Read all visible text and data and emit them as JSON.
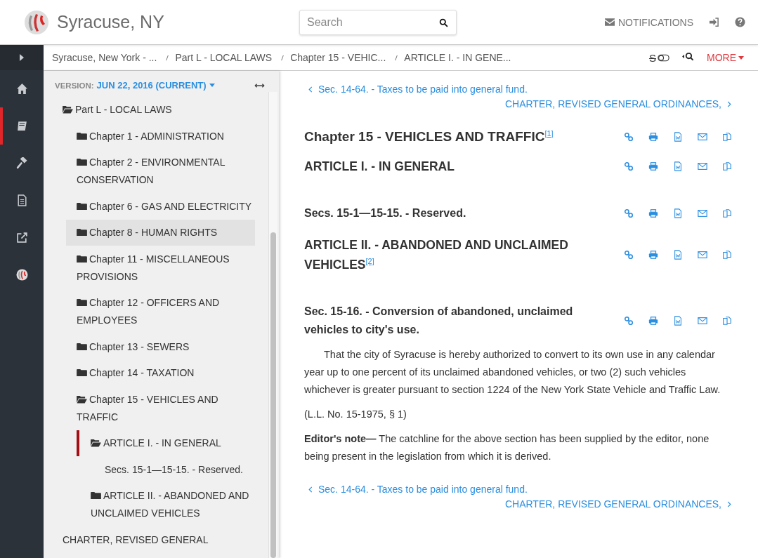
{
  "header": {
    "title": "Syracuse, NY",
    "search": {
      "placeholder": "Search"
    },
    "notifications": "NOTIFICATIONS"
  },
  "rail": {
    "items": [
      {
        "kind": "home",
        "selected": false
      },
      {
        "kind": "book",
        "selected": true
      },
      {
        "kind": "gavel",
        "selected": false
      },
      {
        "kind": "document",
        "selected": false
      },
      {
        "kind": "external",
        "selected": false
      },
      {
        "kind": "logo",
        "selected": false
      }
    ]
  },
  "breadcrumbs": [
    "Syracuse, New York - ...",
    "Part L - LOCAL LAWS",
    "Chapter 15 - VEHIC...",
    "ARTICLE I. - IN GENE..."
  ],
  "toolbar": {
    "compare_glyph": "S",
    "compare_on": false,
    "more": "MORE"
  },
  "sidebar": {
    "version_label": "VERSION:",
    "version": "JUN 22, 2016 (CURRENT)",
    "tree": [
      {
        "kind": "folder",
        "label": "Part L - LOCAL LAWS",
        "expanded": true,
        "selected": false,
        "current": false,
        "children": [
          {
            "kind": "folder",
            "label": "Chapter 1 - ADMINISTRATION",
            "expanded": false,
            "selected": false,
            "current": false
          },
          {
            "kind": "folder",
            "label": "Chapter 2 - ENVIRONMENTAL CONSERVATION",
            "expanded": false,
            "selected": false,
            "current": false
          },
          {
            "kind": "folder",
            "label": "Chapter 6 - GAS AND ELECTRICITY",
            "expanded": false,
            "selected": false,
            "current": false
          },
          {
            "kind": "folder",
            "label": "Chapter 8 - HUMAN RIGHTS",
            "expanded": false,
            "selected": true,
            "current": false
          },
          {
            "kind": "folder",
            "label": "Chapter 11 - MISCELLANEOUS PROVISIONS",
            "expanded": false,
            "selected": false,
            "current": false
          },
          {
            "kind": "folder",
            "label": "Chapter 12 - OFFICERS AND EMPLOYEES",
            "expanded": false,
            "selected": false,
            "current": false
          },
          {
            "kind": "folder",
            "label": "Chapter 13 - SEWERS",
            "expanded": false,
            "selected": false,
            "current": false
          },
          {
            "kind": "folder",
            "label": "Chapter 14 - TAXATION",
            "expanded": false,
            "selected": false,
            "current": false
          },
          {
            "kind": "folder",
            "label": "Chapter 15 - VEHICLES AND TRAFFIC",
            "expanded": true,
            "selected": false,
            "current": false,
            "children": [
              {
                "kind": "folder",
                "label": "ARTICLE I. - IN GENERAL",
                "expanded": true,
                "selected": false,
                "current": true,
                "children": [
                  {
                    "kind": "section",
                    "label": "Secs. 15-1—15-15. - Reserved.",
                    "selected": false,
                    "current": false
                  }
                ]
              },
              {
                "kind": "folder",
                "label": "ARTICLE II. - ABANDONED AND UNCLAIMED VEHICLES",
                "expanded": false,
                "selected": false,
                "current": false
              }
            ]
          }
        ]
      },
      {
        "kind": "section",
        "label": "CHARTER, REVISED GENERAL",
        "selected": false,
        "current": false
      }
    ]
  },
  "content": {
    "prev_top": "Sec. 14-64. - Taxes to be paid into general fund.",
    "next_top": "CHARTER, REVISED GENERAL ORDINANCES,",
    "headings": [
      {
        "kind": "chapter",
        "title": "Chapter 15 - VEHICLES AND TRAFFIC",
        "footnote": "[1]"
      },
      {
        "kind": "article",
        "title": "ARTICLE I. - IN GENERAL"
      },
      {
        "kind": "section",
        "title": "Secs. 15-1—15-15. - Reserved."
      },
      {
        "kind": "article",
        "title": "ARTICLE II. - ABANDONED AND UNCLAIMED VEHICLES",
        "footnote": "[2]"
      },
      {
        "kind": "section",
        "title": "Sec. 15-16. - Conversion of abandoned, unclaimed vehicles to city's use."
      }
    ],
    "paragraphs": [
      {
        "kind": "indented",
        "text": "That the city of Syracuse is hereby authorized to convert to its own use in any calendar year up to one percent of its unclaimed abandoned vehicles, or two (2) such vehicles whichever is greater pursuant to section 1224 of the New York State Vehicle and Traffic Law."
      },
      {
        "kind": "plain",
        "text": "(L.L. No. 15-1975, § 1)"
      },
      {
        "kind": "plain",
        "text": "**Editor's note—** The catchline for the above section has been supplied by the editor, none being present in the legislation from which it is derived."
      }
    ],
    "prev_bottom": "Sec. 14-64. - Taxes to be paid into general fund.",
    "next_bottom": "CHARTER, REVISED GENERAL ORDINANCES,"
  }
}
